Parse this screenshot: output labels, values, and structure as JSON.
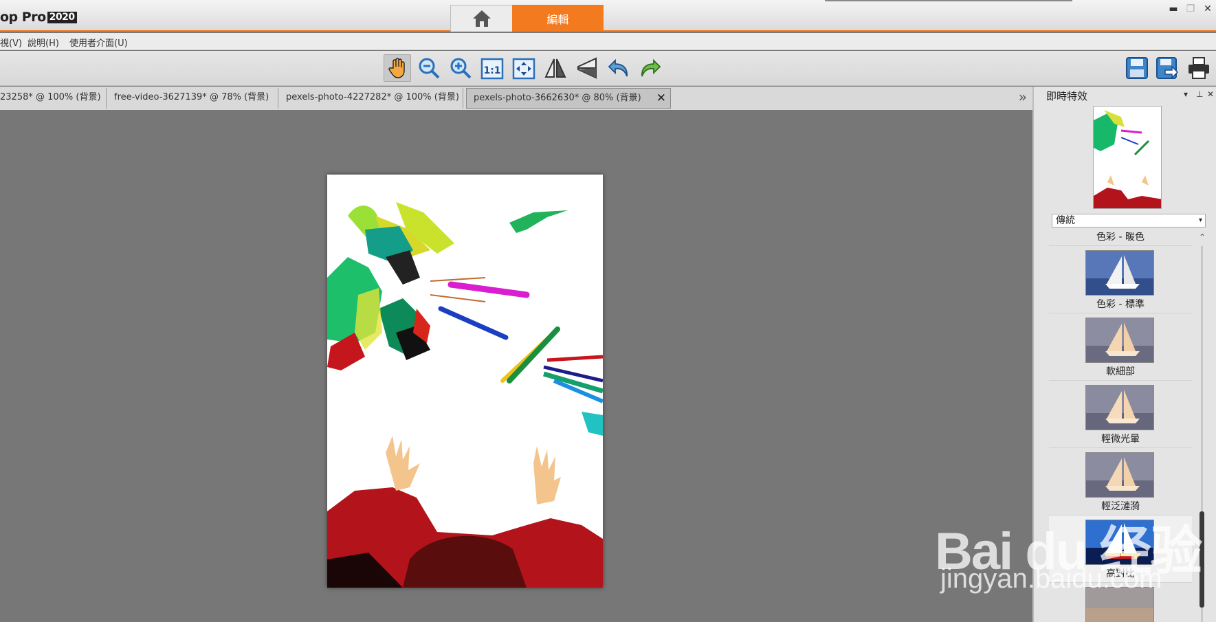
{
  "app": {
    "title": "op Pro",
    "year": "2020"
  },
  "top_tabs": {
    "home_icon": "home-icon",
    "edit_label": "編輯"
  },
  "window_controls": {
    "minimize": "▬",
    "restore": "❐",
    "close": "✕"
  },
  "menu": {
    "items": [
      "視(V)",
      "說明(H)",
      "使用者介面(U)"
    ]
  },
  "toolbar": {
    "tools": [
      "pan-hand-icon",
      "zoom-out-icon",
      "zoom-in-icon",
      "actual-size-1-1-icon",
      "fit-to-window-icon",
      "flip-horizontal-icon",
      "flip-vertical-icon",
      "undo-icon",
      "redo-icon"
    ],
    "right_tools": [
      "save-icon",
      "save-as-icon",
      "print-icon"
    ],
    "actual_size_label": "1:1"
  },
  "doc_tabs": [
    {
      "label": "23258* @ 100% (背景)"
    },
    {
      "label": "free-video-3627139* @  78% (背景)"
    },
    {
      "label": "pexels-photo-4227282* @ 100% (背景)"
    },
    {
      "label": "pexels-photo-3662630* @  80% (背景)",
      "active": true
    }
  ],
  "doc_tab_close": "✕",
  "doc_tabs_scroll": "»",
  "panel": {
    "title": "即時特效",
    "controls": [
      "▾",
      "⊥",
      "✕"
    ],
    "preset_select": "傳統",
    "effects": [
      {
        "label": "色彩 - 暖色"
      },
      {
        "label": "色彩 - 標準"
      },
      {
        "label": "軟細部"
      },
      {
        "label": "輕微光暈"
      },
      {
        "label": "輕泛漣漪"
      },
      {
        "label": "高對比"
      },
      {
        "label": ""
      }
    ]
  },
  "watermark": {
    "brand": "Bai du 经验",
    "url": "jingyan.baidu.com"
  },
  "colors": {
    "accent": "#f47a20",
    "canvas": "#777777",
    "panel": "#e4e4e4"
  }
}
